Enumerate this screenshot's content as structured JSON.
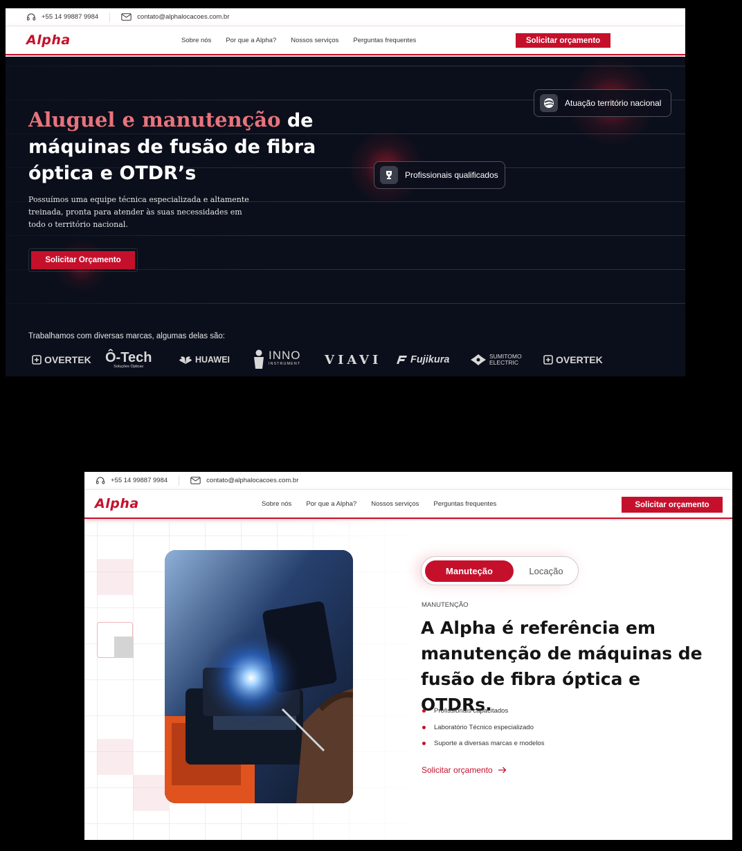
{
  "contact": {
    "phone": "+55 14 99887 9984",
    "email": "contato@alphalocacoes.com.br"
  },
  "brand": {
    "logo": "Alpha"
  },
  "nav": {
    "items": [
      "Sobre nós",
      "Por que a Alpha?",
      "Nossos serviços",
      "Perguntas frequentes"
    ],
    "cta": "Solicitar orçamento"
  },
  "hero": {
    "title_accent": "Aluguel e manutenção",
    "title_rest": " de máquinas de fusão de fibra óptica e OTDR’s",
    "description": "Possuímos uma equipe técnica especializada e altamente treinada, pronta para atender às suas necessidades em todo o território nacional.",
    "button": "Solicitar Orçamento",
    "badges": {
      "national": "Atuação território nacional",
      "professionals": "Profissionais qualificados"
    },
    "brands_title": "Trabalhamos com diversas marcas, algumas delas são:",
    "brands": {
      "overtek": "OVERTEK",
      "otech": "Ô-Tech",
      "otech_sub": "Soluções Ópticas",
      "huawei": "HUAWEI",
      "inno": "INNO",
      "inno_sub": "INSTRUMENT",
      "viavi": "VIAVI",
      "fujikura": "Fujikura",
      "sumitomo": "SUMITOMO",
      "sumitomo_sub": "ELECTRIC",
      "overtek2": "OVERTEK"
    }
  },
  "section2": {
    "tabs": {
      "active": "Manuteção",
      "inactive": "Locação"
    },
    "eyebrow": "MANUTENÇÃO",
    "title": "A Alpha é referência em manutenção de máquinas de fusão de fibra óptica e OTDRs.",
    "bullets": [
      "Profissionais capacitados",
      "Laboratório Técnico especializado",
      "Suporte a diversas marcas e modelos"
    ],
    "link": "Solicitar orçamento",
    "link_icon": "arrow-right-icon"
  },
  "colors": {
    "accent": "#c5102c",
    "hero_bg": "#0b0f1b",
    "accent_text": "#e8737c"
  }
}
